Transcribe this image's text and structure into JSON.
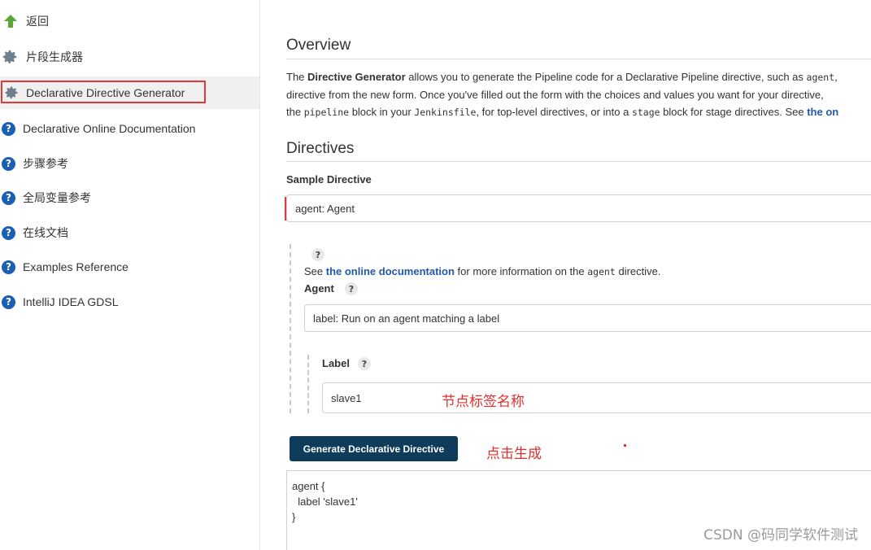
{
  "sidebar": {
    "items": [
      {
        "label": "返回",
        "icon": "up-arrow-icon"
      },
      {
        "label": "片段生成器",
        "icon": "gear-icon"
      },
      {
        "label": "Declarative Directive Generator",
        "icon": "gear-icon"
      },
      {
        "label": "Declarative Online Documentation",
        "icon": "help-icon"
      },
      {
        "label": "步骤参考",
        "icon": "help-icon"
      },
      {
        "label": "全局变量参考",
        "icon": "help-icon"
      },
      {
        "label": "在线文档",
        "icon": "help-icon"
      },
      {
        "label": "Examples Reference",
        "icon": "help-icon"
      },
      {
        "label": "IntelliJ IDEA GDSL",
        "icon": "help-icon"
      }
    ],
    "active_index": 2
  },
  "overview": {
    "title": "Overview",
    "line1_pre": "The ",
    "line1_bold": "Directive Generator",
    "line1_post": " allows you to generate the Pipeline code for a Declarative Pipeline directive, such as ",
    "line1_code": "agent",
    "line1_end": ",",
    "line2": "directive from the new form. Once you've filled out the form with the choices and values you want for your directive,",
    "line3_pre": "the ",
    "line3_code1": "pipeline",
    "line3_mid1": " block in your ",
    "line3_code2": "Jenkinsfile",
    "line3_mid2": ", for top-level directives, or into a ",
    "line3_code3": "stage",
    "line3_mid3": " block for stage directives. See ",
    "line3_link": "the on"
  },
  "directives": {
    "title": "Directives",
    "sample_label": "Sample Directive",
    "sample_value": "agent: Agent",
    "help_q": "?",
    "see_pre": "See ",
    "see_link": "the online documentation",
    "see_mid": " for more information on the ",
    "see_code": "agent",
    "see_post": " directive.",
    "agent_label": "Agent",
    "agent_value": "label: Run on an agent matching a label",
    "label_label": "Label",
    "label_value": "slave1"
  },
  "generate_button": "Generate Declarative Directive",
  "output_code": "agent {\n  label 'slave1'\n}",
  "annotations": {
    "label_note": "节点标签名称",
    "click_note": "点击生成"
  },
  "watermark": "CSDN @码同学软件测试",
  "colors": {
    "accent_button": "#0f3c5a",
    "link": "#1f5aa6",
    "annotation": "#e0302e",
    "help_icon": "#1a5fb4"
  }
}
